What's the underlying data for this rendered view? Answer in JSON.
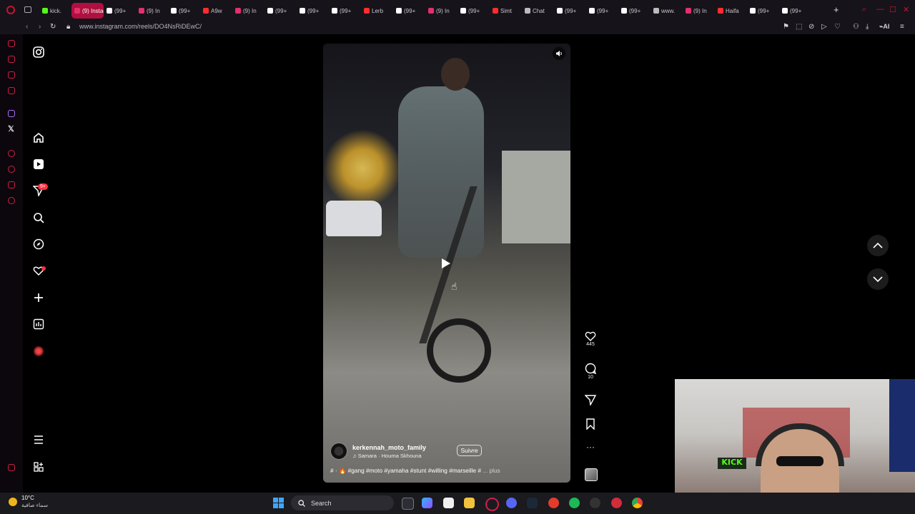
{
  "browser": {
    "tabs": [
      {
        "label": "kick.",
        "color": "#53fc18",
        "active": false
      },
      {
        "label": "(9) Instag",
        "color": "#e1306c",
        "active": true
      },
      {
        "label": "(99+",
        "color": "#ffffff",
        "active": false
      },
      {
        "label": "(9) In",
        "color": "#e1306c",
        "active": false
      },
      {
        "label": "(99+",
        "color": "#ffffff",
        "active": false
      },
      {
        "label": "A9w",
        "color": "#ff2d2d",
        "active": false
      },
      {
        "label": "(9) In",
        "color": "#e1306c",
        "active": false
      },
      {
        "label": "(99+",
        "color": "#ffffff",
        "active": false
      },
      {
        "label": "(99+",
        "color": "#ffffff",
        "active": false
      },
      {
        "label": "(99+",
        "color": "#ffffff",
        "active": false
      },
      {
        "label": "Lerb",
        "color": "#ff2d2d",
        "active": false
      },
      {
        "label": "(99+",
        "color": "#ffffff",
        "active": false
      },
      {
        "label": "(9) In",
        "color": "#e1306c",
        "active": false
      },
      {
        "label": "(99+",
        "color": "#ffffff",
        "active": false
      },
      {
        "label": "Simt",
        "color": "#ff2d2d",
        "active": false
      },
      {
        "label": "Chat",
        "color": "#bbbbbb",
        "active": false
      },
      {
        "label": "(99+",
        "color": "#ffffff",
        "active": false
      },
      {
        "label": "(99+",
        "color": "#ffffff",
        "active": false
      },
      {
        "label": "(99+",
        "color": "#ffffff",
        "active": false
      },
      {
        "label": "www.",
        "color": "#bbbbbb",
        "active": false
      },
      {
        "label": "(9) In",
        "color": "#e1306c",
        "active": false
      },
      {
        "label": "Haifa",
        "color": "#ff2d2d",
        "active": false
      },
      {
        "label": "(99+",
        "color": "#ffffff",
        "active": false
      },
      {
        "label": "(99+",
        "color": "#ffffff",
        "active": false
      }
    ],
    "url": "www.instagram.com/reels/DO4NsRiDEwC/",
    "ai_label": "AI"
  },
  "instagram": {
    "notification_badge": "9+",
    "nav_items": [
      "instagram-logo",
      "home-icon",
      "reels-icon",
      "messages-icon",
      "search-icon",
      "explore-icon",
      "notifications-icon",
      "create-icon",
      "dashboard-icon",
      "profile-avatar",
      "menu-icon",
      "more-apps-icon"
    ]
  },
  "reel": {
    "username": "kerkennah_moto_family",
    "audio": "Samara · Houma Skhouna",
    "follow_label": "Suivre",
    "caption": "# · 🔥 #gang #moto #yamaha #stunt #willing #marseille #",
    "more_label": "... plus",
    "likes": "445",
    "comments": "10"
  },
  "taskbar": {
    "temperature": "10°C",
    "condition": "سماء صافية",
    "search_label": "Search"
  },
  "colors": {
    "accent": "#b0103f",
    "instagram_red": "#ff3040",
    "background": "#000000"
  }
}
